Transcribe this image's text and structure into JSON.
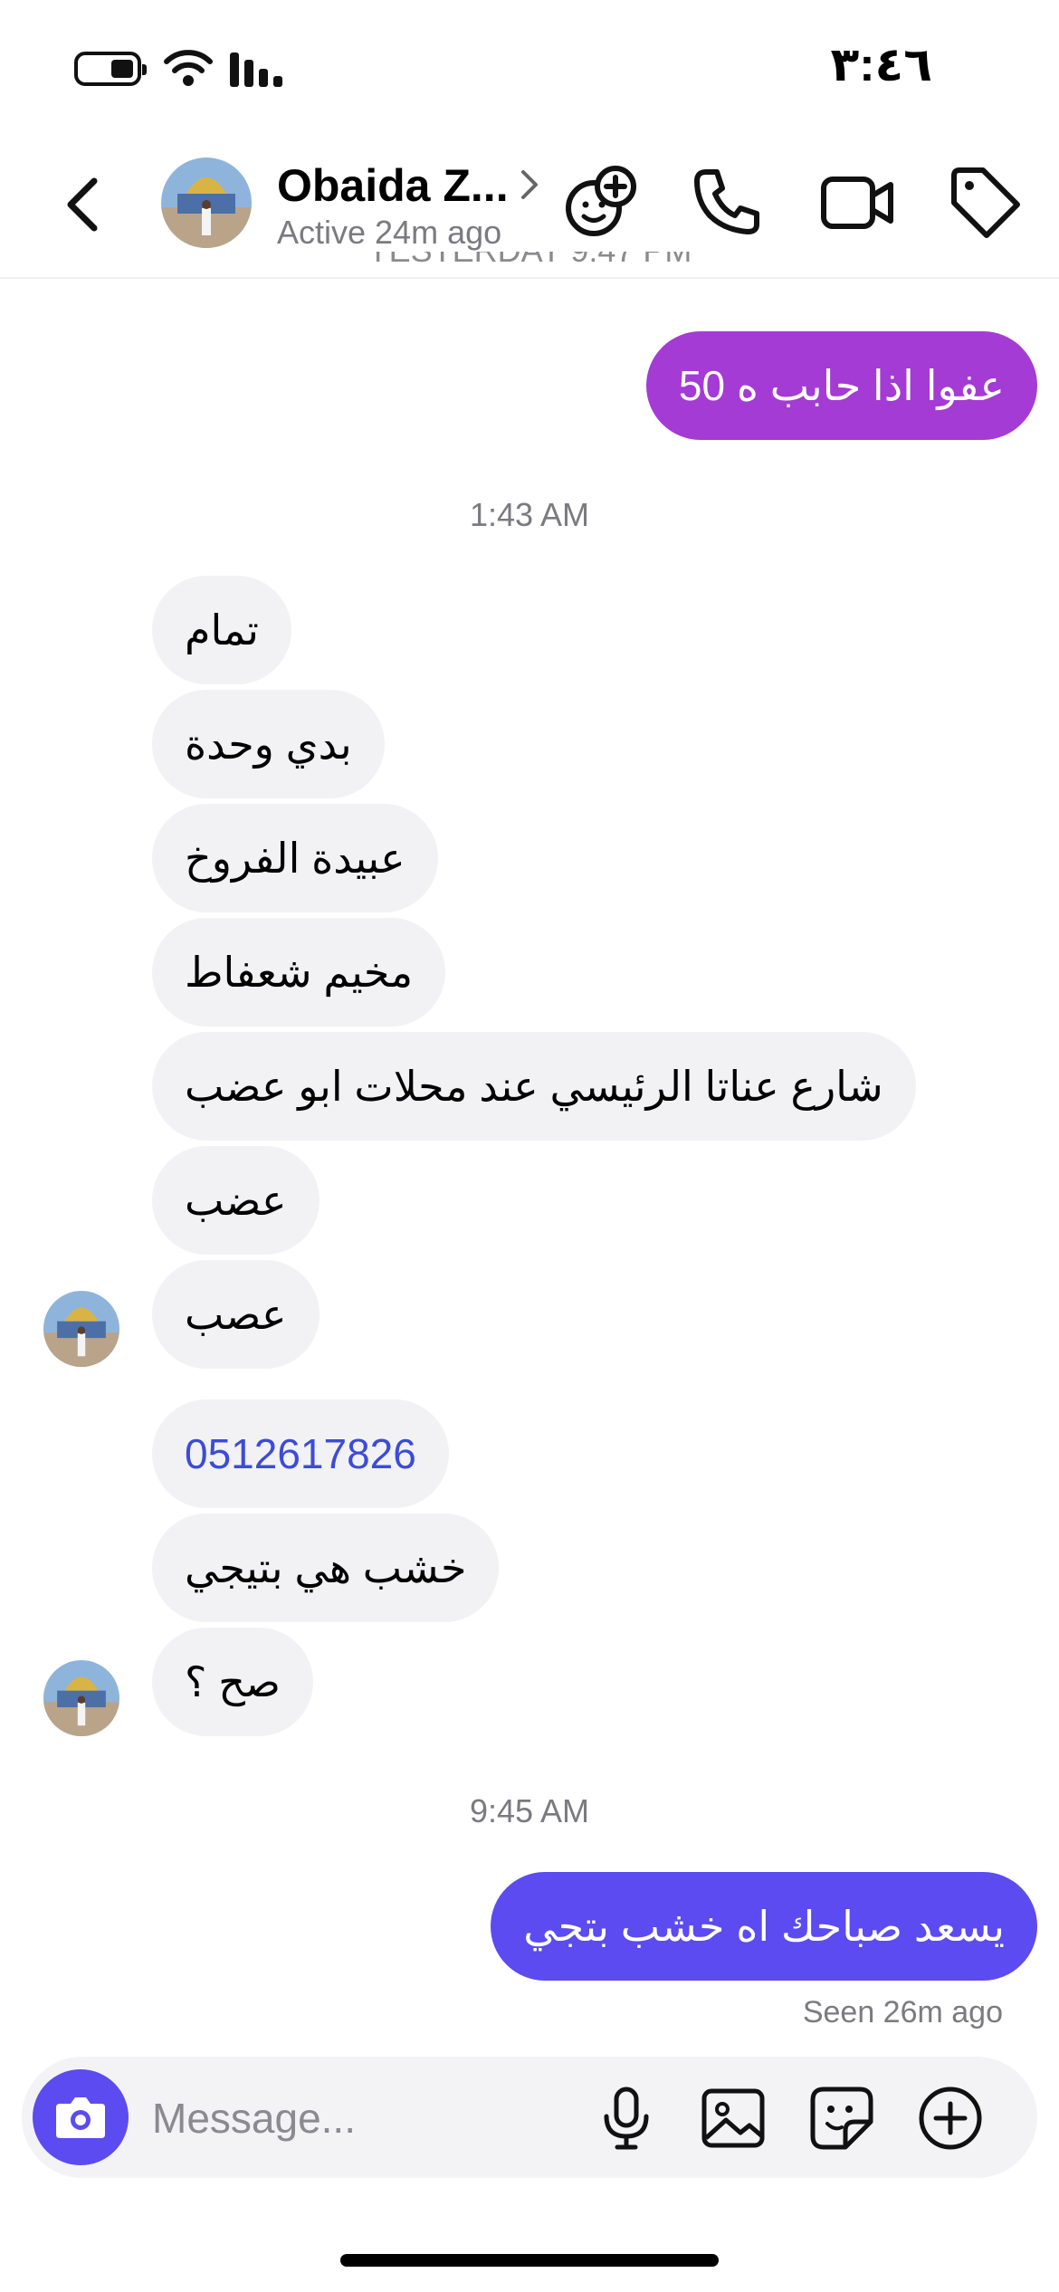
{
  "status_bar": {
    "time": "٣:٤٦"
  },
  "header": {
    "contact_name": "Obaida Z...",
    "active_status": "Active 24m ago"
  },
  "conversation": {
    "previous_timestamp": "YESTERDAY 9:47 PM",
    "sent_top": "عفوا اذا حابب ه 50",
    "timestamp_1": "1:43 AM",
    "received_group_1": [
      "تمام",
      "بدي وحدة",
      "عبيدة الفروخ",
      "مخيم شعفاط",
      "شارع عناتا الرئيسي عند محلات ابو عضب",
      "عضب",
      "عصب"
    ],
    "received_group_2": [
      "0512617826",
      "خشب هي بتيجي",
      "صح ؟"
    ],
    "timestamp_2": "9:45 AM",
    "sent_bottom": "يسعد صباحك اه خشب بتجي",
    "seen": "Seen 26m ago"
  },
  "composer": {
    "placeholder": "Message..."
  },
  "colors": {
    "sent_purple": "#a43bd4",
    "sent_blue": "#5b4bf0",
    "received_bubble": "#f2f2f4",
    "link": "#3d4bd8"
  },
  "icons": {
    "back": "chevron-left-icon",
    "add_friend": "add-friend-icon",
    "call": "phone-icon",
    "video": "video-camera-icon",
    "tag": "tag-icon",
    "camera": "camera-icon",
    "mic": "microphone-icon",
    "image": "image-icon",
    "sticker": "sticker-icon",
    "plus": "plus-circle-icon"
  }
}
